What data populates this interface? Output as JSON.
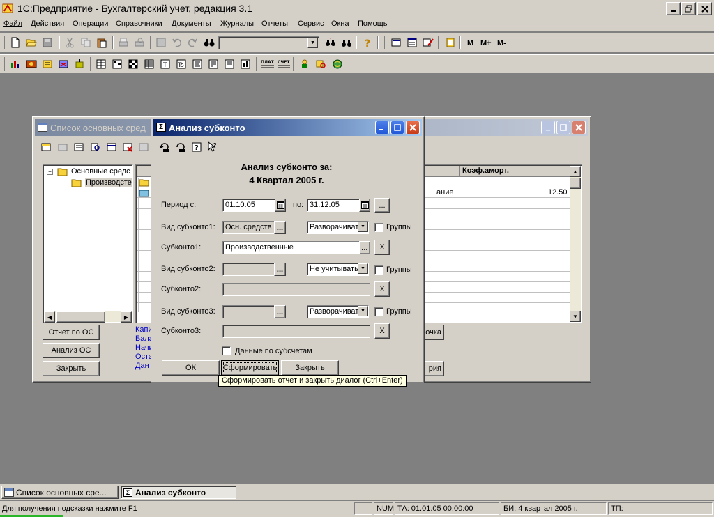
{
  "app": {
    "title": "1С:Предприятие - Бухгалтерский учет, редакция 3.1",
    "menu": [
      "Файл",
      "Действия",
      "Операции",
      "Справочники",
      "Документы",
      "Журналы",
      "Отчеты",
      "Сервис",
      "Окна",
      "Помощь"
    ],
    "toolbar_text_buttons": [
      "М",
      "М+",
      "М-"
    ]
  },
  "os_window": {
    "title": "Список основных сред",
    "tree": [
      "Основные средс",
      "Производсте"
    ],
    "column_header": "Коэф.аморт.",
    "row_name_fragment": "ание",
    "row_value": "12.50",
    "buttons": [
      "Отчет по ОС",
      "Анализ ОС",
      "Закрыть"
    ],
    "links": [
      "Капи",
      "Бала",
      "Начи",
      "Оста",
      "Дан"
    ],
    "right_buttons": [
      "очка",
      "рия"
    ]
  },
  "dialog": {
    "title": "Анализ субконто",
    "heading_line1": "Анализ субконто за:",
    "heading_line2": "4 Квартал 2005 г.",
    "period_from_label": "Период с:",
    "period_from": "01.10.05",
    "period_to_label": "по:",
    "period_to": "31.12.05",
    "ellipsis": "...",
    "vid1_label": "Вид субконто1:",
    "vid1_value": "Осн. средств",
    "vid1_mode": "Разворачиват",
    "groups_label": "Группы",
    "sub1_label": "Субконто1:",
    "sub1_value": "Производственные",
    "vid2_label": "Вид субконто2:",
    "vid2_value": "",
    "vid2_mode": "Не учитывать",
    "sub2_label": "Субконто2:",
    "vid3_label": "Вид субконто3:",
    "vid3_value": "",
    "vid3_mode": "Разворачиват",
    "sub3_label": "Субконто3:",
    "clear": "X",
    "subaccounts_label": "Данные по субсчетам",
    "ok": "ОК",
    "generate": "Сформировать",
    "close": "Закрыть",
    "tooltip": "Сформировать отчет и закрыть диалог (Ctrl+Enter)"
  },
  "taskbar": {
    "item1": "Список основных сре...",
    "item2": "Анализ субконто"
  },
  "status": {
    "hint": "Для получения подсказки нажмите F1",
    "num": "NUM",
    "ta": "ТА: 01.01.05  00:00:00",
    "bi": "БИ: 4 квартал 2005 г.",
    "tp": "ТП:"
  }
}
